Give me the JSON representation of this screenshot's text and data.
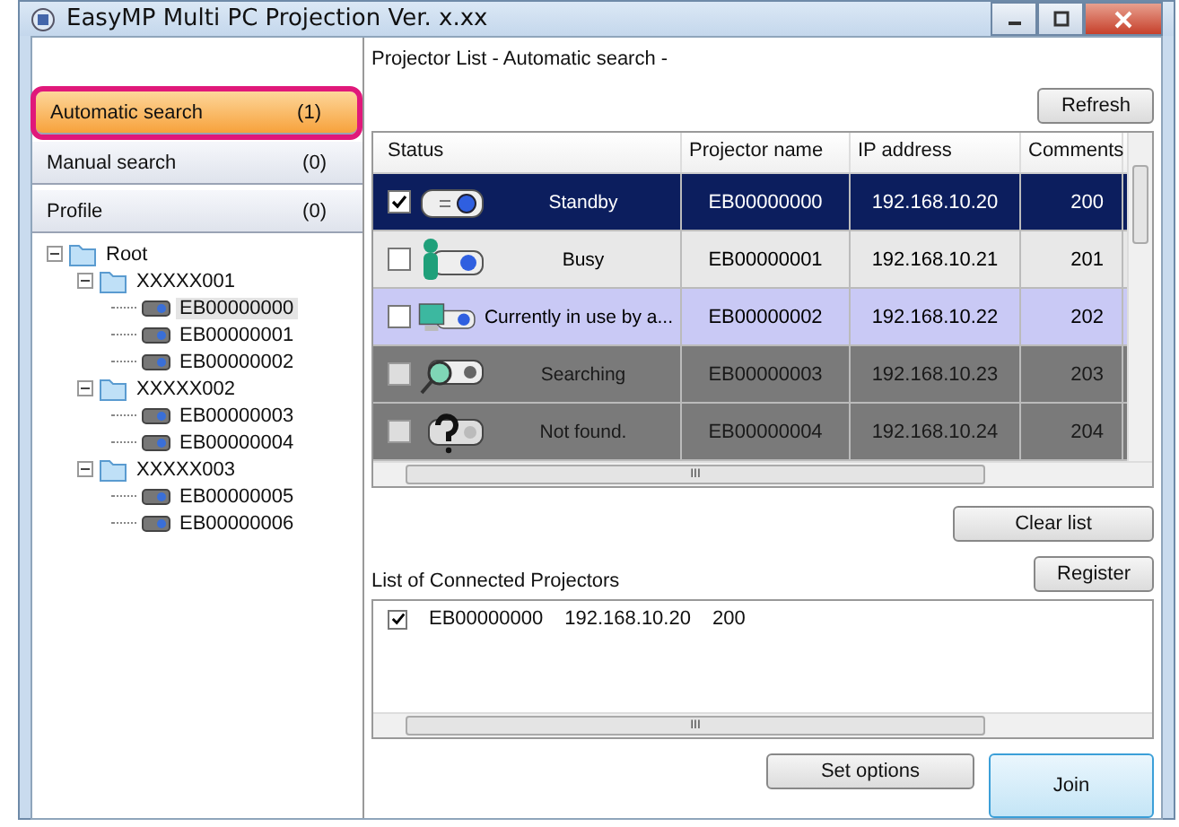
{
  "window": {
    "title": "EasyMP Multi PC Projection Ver. x.xx"
  },
  "search_modes": [
    {
      "label": "Automatic search",
      "count": "(1)",
      "selected": true
    },
    {
      "label": "Manual search",
      "count": "(0)",
      "selected": false
    },
    {
      "label": "Profile",
      "count": "(0)",
      "selected": false
    }
  ],
  "tree": {
    "label": "Root",
    "expanded": true,
    "children": [
      {
        "label": "XXXXX001",
        "expanded": true,
        "children": [
          {
            "label": "EB00000000",
            "selected": true
          },
          {
            "label": "EB00000001",
            "selected": false
          },
          {
            "label": "EB00000002",
            "selected": false
          }
        ]
      },
      {
        "label": "XXXXX002",
        "expanded": true,
        "children": [
          {
            "label": "EB00000003",
            "selected": false
          },
          {
            "label": "EB00000004",
            "selected": false
          }
        ]
      },
      {
        "label": "XXXXX003",
        "expanded": true,
        "children": [
          {
            "label": "EB00000005",
            "selected": false
          },
          {
            "label": "EB00000006",
            "selected": false
          }
        ]
      }
    ]
  },
  "projector_list": {
    "heading": "Projector List - Automatic search -",
    "refresh_button": "Refresh",
    "columns": [
      "Status",
      "Projector name",
      "IP address",
      "Comments"
    ],
    "rows": [
      {
        "kind": "standby",
        "checked": true,
        "selected": true,
        "status": "Standby",
        "name": "EB00000000",
        "ip": "192.168.10.20",
        "comment": "200"
      },
      {
        "kind": "busy",
        "checked": false,
        "selected": false,
        "status": "Busy",
        "name": "EB00000001",
        "ip": "192.168.10.21",
        "comment": "201"
      },
      {
        "kind": "in_use",
        "checked": false,
        "selected": false,
        "status": "Currently in use by a...",
        "name": "EB00000002",
        "ip": "192.168.10.22",
        "comment": "202"
      },
      {
        "kind": "searching",
        "checked": false,
        "selected": false,
        "status": "Searching",
        "name": "EB00000003",
        "ip": "192.168.10.23",
        "comment": "203"
      },
      {
        "kind": "not_found",
        "checked": false,
        "selected": false,
        "status": "Not found.",
        "name": "EB00000004",
        "ip": "192.168.10.24",
        "comment": "204"
      }
    ],
    "h_scroll_grip": "III",
    "clear_button": "Clear list"
  },
  "connected": {
    "heading": "List of Connected Projectors",
    "register_button": "Register",
    "items": [
      {
        "checked": true,
        "name": "EB00000000",
        "ip": "192.168.10.20",
        "comment": "200"
      }
    ],
    "h_scroll_grip": "III"
  },
  "buttons": {
    "options": "Set options",
    "join": "Join"
  }
}
